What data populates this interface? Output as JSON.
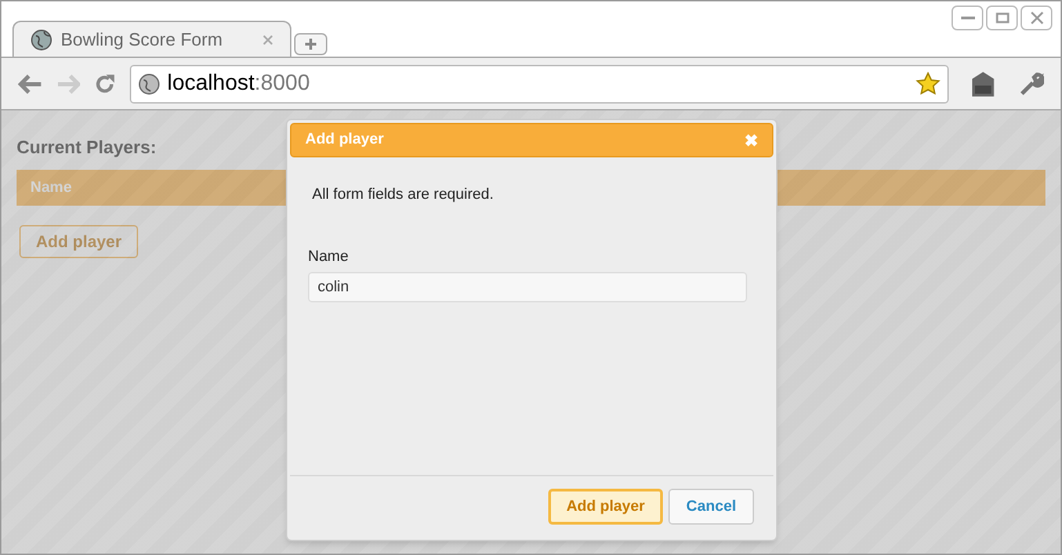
{
  "browser": {
    "tab_title": "Bowling Score Form",
    "url_host": "localhost",
    "url_port": ":8000"
  },
  "page": {
    "heading": "Current Players:",
    "table": {
      "columns": [
        "Name"
      ]
    },
    "button": "Add player"
  },
  "dialog": {
    "title": "Add player",
    "close": "✖",
    "message": "All form fields are required.",
    "field": {
      "label": "Name",
      "value": "colin"
    },
    "buttons": [
      {
        "label": "Add player",
        "kind": "primary"
      },
      {
        "label": "Cancel",
        "kind": "secondary"
      }
    ]
  }
}
